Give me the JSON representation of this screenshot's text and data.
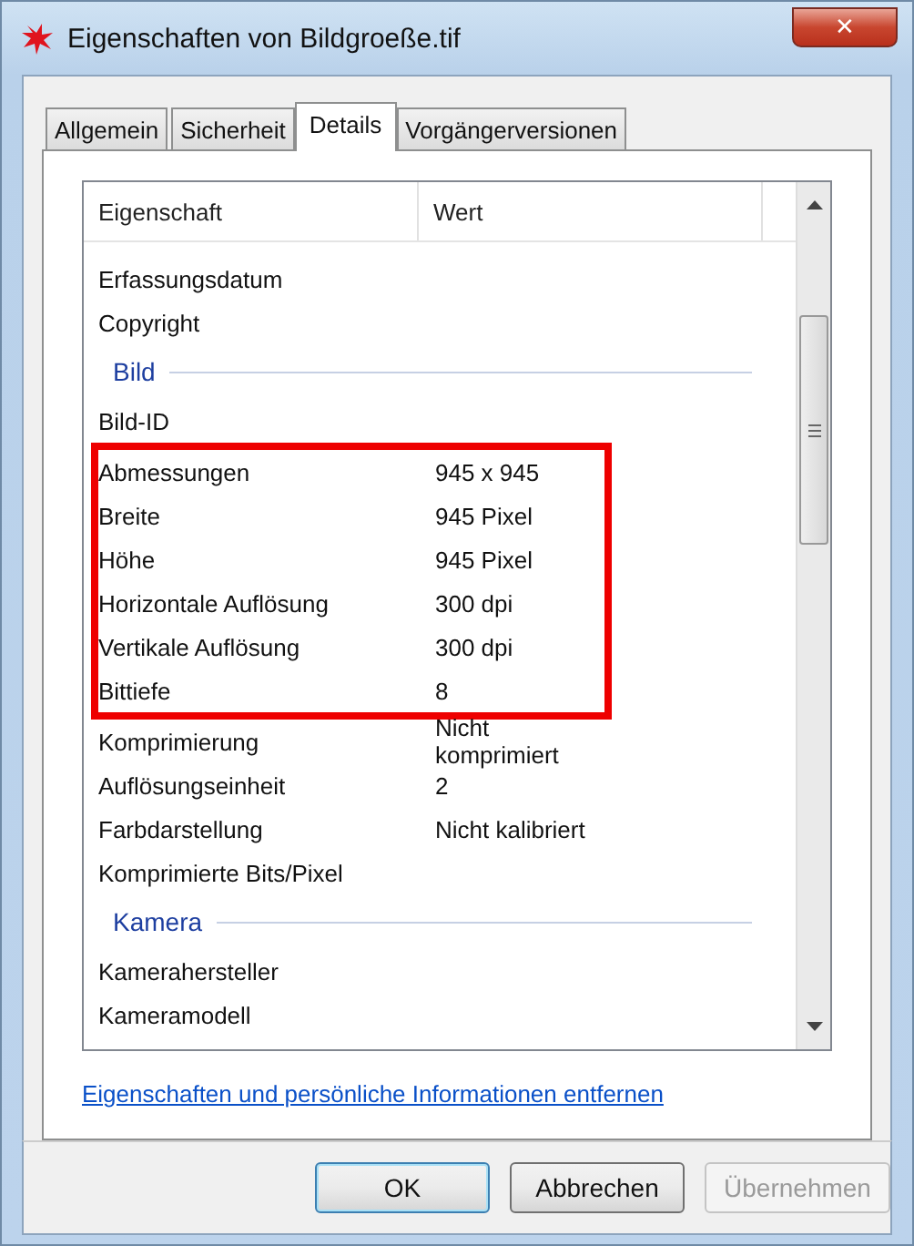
{
  "window": {
    "title": "Eigenschaften von Bildgroeße.tif",
    "close": "✕"
  },
  "tabs": [
    {
      "label": "Allgemein",
      "selected": false
    },
    {
      "label": "Sicherheit",
      "selected": false
    },
    {
      "label": "Details",
      "selected": true
    },
    {
      "label": "Vorgängerversionen",
      "selected": false
    }
  ],
  "table": {
    "columns": [
      "Eigenschaft",
      "Wert"
    ],
    "rows": [
      {
        "kind": "row",
        "name": "Erfassungsdatum",
        "value": "",
        "highlighted": false
      },
      {
        "kind": "row",
        "name": "Copyright",
        "value": "",
        "highlighted": false
      },
      {
        "kind": "section",
        "name": "Bild"
      },
      {
        "kind": "row",
        "name": "Bild-ID",
        "value": "",
        "highlighted": false
      },
      {
        "kind": "row",
        "name": "Abmessungen",
        "value": "945 x 945",
        "highlighted": true
      },
      {
        "kind": "row",
        "name": "Breite",
        "value": "945 Pixel",
        "highlighted": true
      },
      {
        "kind": "row",
        "name": "Höhe",
        "value": "945 Pixel",
        "highlighted": true
      },
      {
        "kind": "row",
        "name": "Horizontale Auflösung",
        "value": "300 dpi",
        "highlighted": true
      },
      {
        "kind": "row",
        "name": "Vertikale Auflösung",
        "value": "300 dpi",
        "highlighted": true
      },
      {
        "kind": "row",
        "name": "Bittiefe",
        "value": "8",
        "highlighted": true
      },
      {
        "kind": "row",
        "name": "Komprimierung",
        "value": "Nicht komprimiert",
        "highlighted": false
      },
      {
        "kind": "row",
        "name": "Auflösungseinheit",
        "value": "2",
        "highlighted": false
      },
      {
        "kind": "row",
        "name": "Farbdarstellung",
        "value": "Nicht kalibriert",
        "highlighted": false
      },
      {
        "kind": "row",
        "name": "Komprimierte Bits/Pixel",
        "value": "",
        "highlighted": false
      },
      {
        "kind": "section",
        "name": "Kamera"
      },
      {
        "kind": "row",
        "name": "Kamerahersteller",
        "value": "",
        "highlighted": false
      },
      {
        "kind": "row",
        "name": "Kameramodell",
        "value": "",
        "highlighted": false
      }
    ]
  },
  "link": "Eigenschaften und persönliche Informationen entfernen",
  "buttons": [
    {
      "label": "OK",
      "disabled": false,
      "default": true
    },
    {
      "label": "Abbrechen",
      "disabled": false,
      "default": false
    },
    {
      "label": "Übernehmen",
      "disabled": true,
      "default": false
    }
  ]
}
